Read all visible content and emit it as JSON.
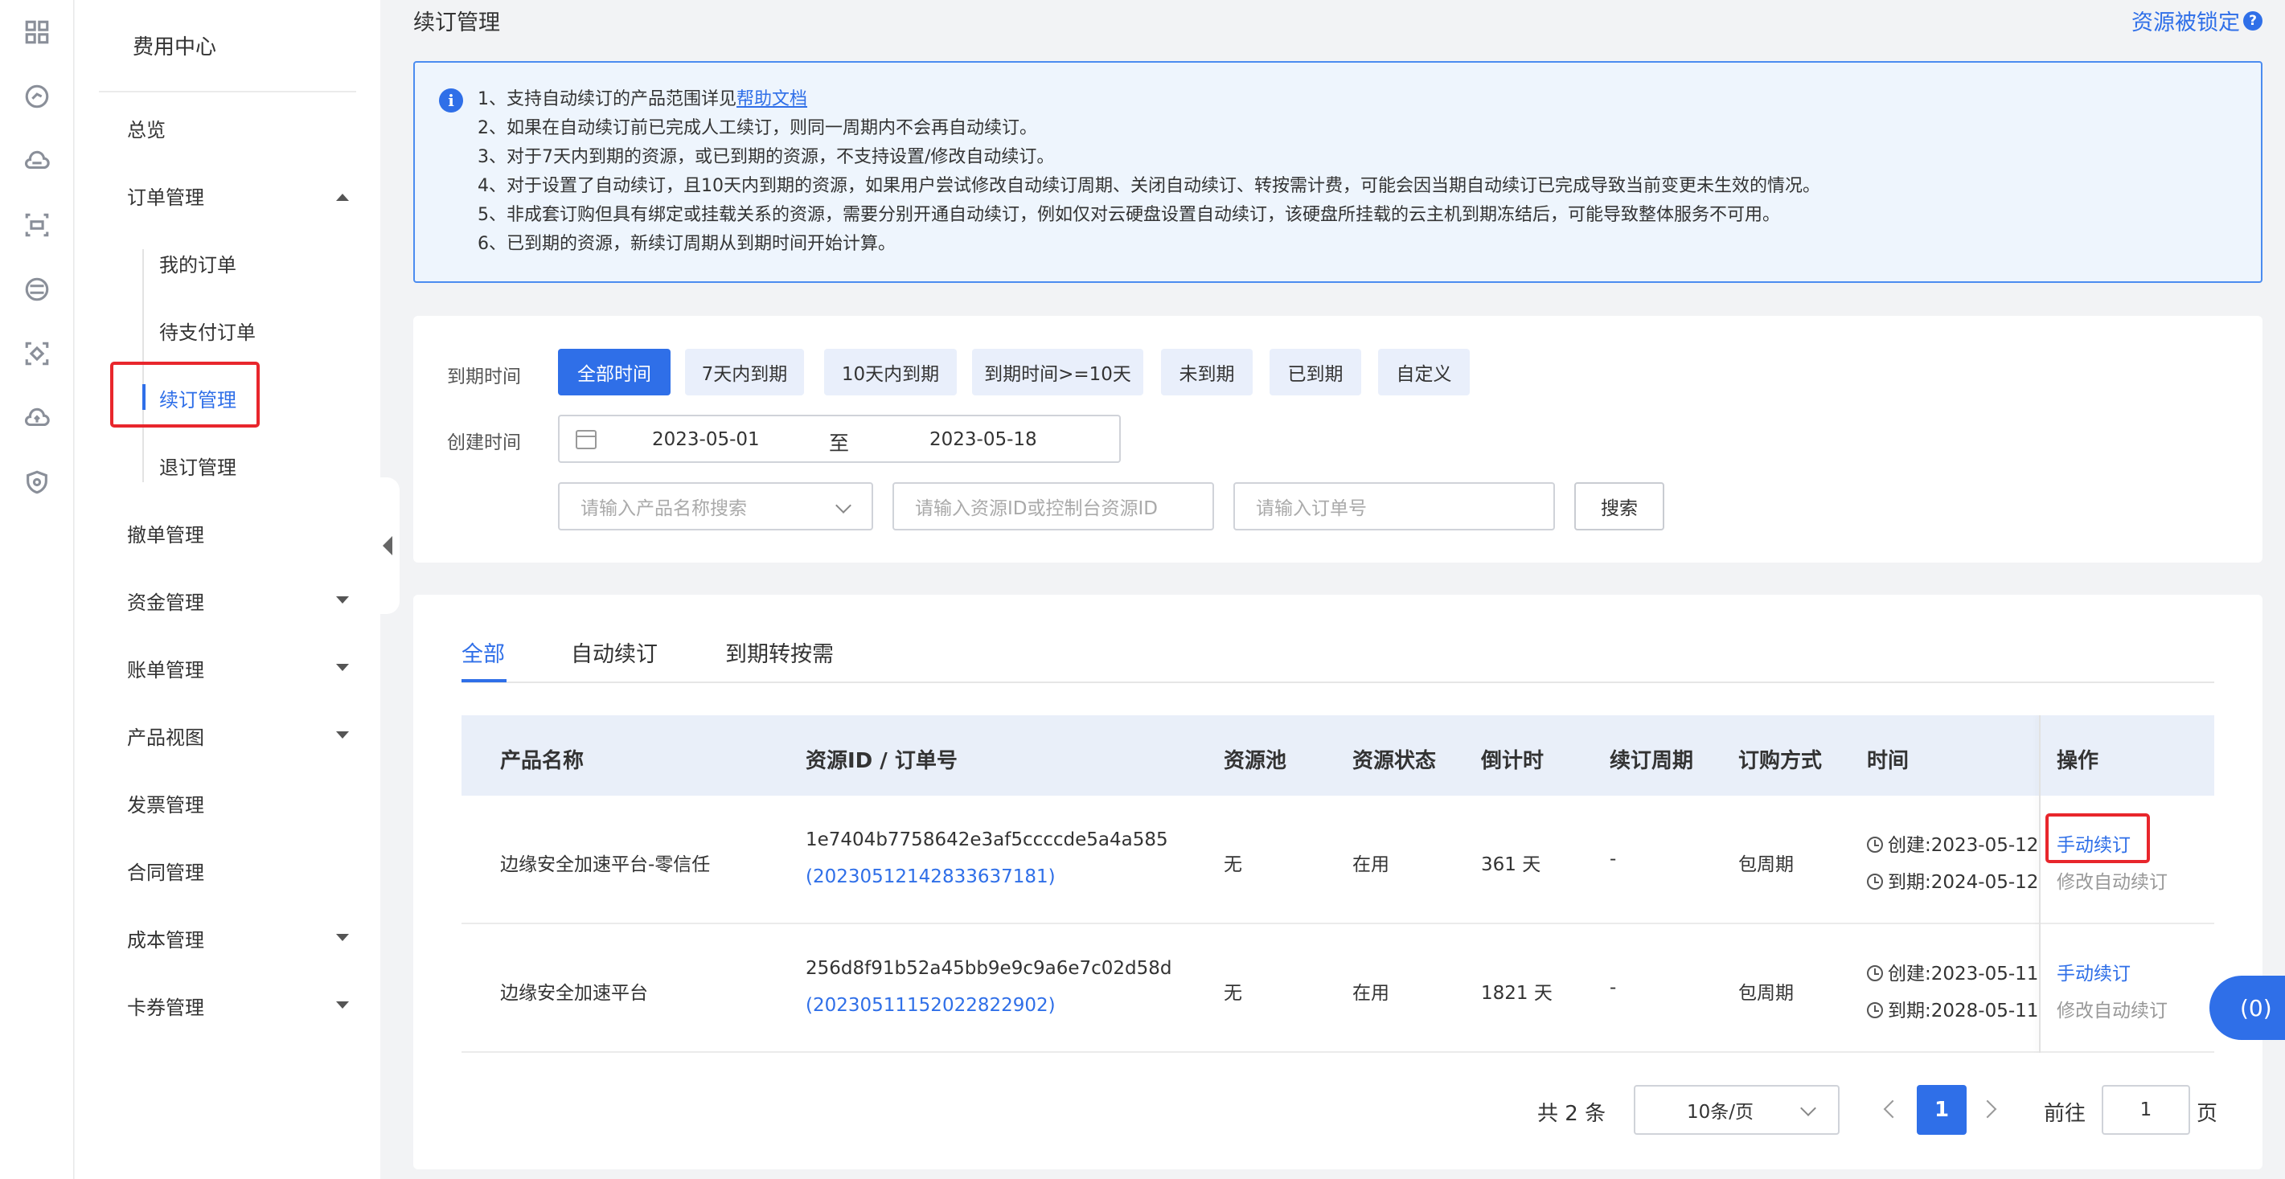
{
  "rail": {
    "icons": [
      "grid-icon",
      "speed-icon",
      "cloud-icon",
      "network-icon",
      "storage-icon",
      "scan-icon",
      "cloud-upload-icon",
      "shield-icon"
    ]
  },
  "sidebar": {
    "title": "费用中心",
    "items": {
      "overview": "总览",
      "orders": "订单管理",
      "my_orders": "我的订单",
      "pending_orders": "待支付订单",
      "renewal": "续订管理",
      "refund": "退订管理",
      "withdraw": "撤单管理",
      "funds": "资金管理",
      "bills": "账单管理",
      "product_view": "产品视图",
      "invoice": "发票管理",
      "contract": "合同管理",
      "cost": "成本管理",
      "coupon": "卡券管理"
    },
    "active_item": "续订管理"
  },
  "header": {
    "title": "续订管理",
    "lock_link": "资源被锁定",
    "help_icon": "?"
  },
  "notice": {
    "icon": "i",
    "line1_prefix": "1、支持自动续订的产品范围详见",
    "line1_link": "帮助文档",
    "line2": "2、如果在自动续订前已完成人工续订，则同一周期内不会再自动续订。",
    "line3": "3、对于7天内到期的资源，或已到期的资源，不支持设置/修改自动续订。",
    "line4": "4、对于设置了自动续订，且10天内到期的资源，如果用户尝试修改自动续订周期、关闭自动续订、转按需计费，可能会因当期自动续订已完成导致当前变更未生效的情况。",
    "line5": "5、非成套订购但具有绑定或挂载关系的资源，需要分别开通自动续订，例如仅对云硬盘设置自动续订，该硬盘所挂载的云主机到期冻结后，可能导致整体服务不可用。",
    "line6": "6、已到期的资源，新续订周期从到期时间开始计算。"
  },
  "filters": {
    "expire_label": "到期时间",
    "expire_options": [
      "全部时间",
      "7天内到期",
      "10天内到期",
      "到期时间>=10天",
      "未到期",
      "已到期",
      "自定义"
    ],
    "expire_selected": "全部时间",
    "created_label": "创建时间",
    "date_start": "2023-05-01",
    "date_sep": "至",
    "date_end": "2023-05-18",
    "product_placeholder": "请输入产品名称搜索",
    "resource_placeholder": "请输入资源ID或控制台资源ID",
    "order_placeholder": "请输入订单号",
    "search_button": "搜索"
  },
  "tabs": [
    "全部",
    "自动续订",
    "到期转按需"
  ],
  "table": {
    "columns": [
      "产品名称",
      "资源ID / 订单号",
      "资源池",
      "资源状态",
      "倒计时",
      "续订周期",
      "订购方式",
      "时间",
      "操作"
    ],
    "rows": [
      {
        "product": "边缘安全加速平台-零信任",
        "resource_id": "1e7404b7758642e3af5ccccde5a4a585",
        "order_no": "(20230512142833637181)",
        "pool": "无",
        "status": "在用",
        "countdown": "361 天",
        "cycle": "-",
        "method": "包周期",
        "created": "创建:2023-05-12",
        "expires": "到期:2024-05-12",
        "action_renew": "手动续订",
        "action_modify": "修改自动续订"
      },
      {
        "product": "边缘安全加速平台",
        "resource_id": "256d8f91b52a45bb9e9c9a6e7c02d58d",
        "order_no": "(20230511152022822902)",
        "pool": "无",
        "status": "在用",
        "countdown": "1821 天",
        "cycle": "-",
        "method": "包周期",
        "created": "创建:2023-05-11",
        "expires": "到期:2028-05-11",
        "action_renew": "手动续订",
        "action_modify": "修改自动续订"
      }
    ]
  },
  "pagination": {
    "total": "共 2 条",
    "page_size": "10条/页",
    "current_page": "1",
    "goto_label": "前往",
    "goto_value": "1",
    "page_suffix": "页"
  },
  "float_badge": "(0)",
  "colors": {
    "primary": "#2f6fe8",
    "highlight_border": "#e8262c",
    "notice_bg": "#eef5fd"
  }
}
